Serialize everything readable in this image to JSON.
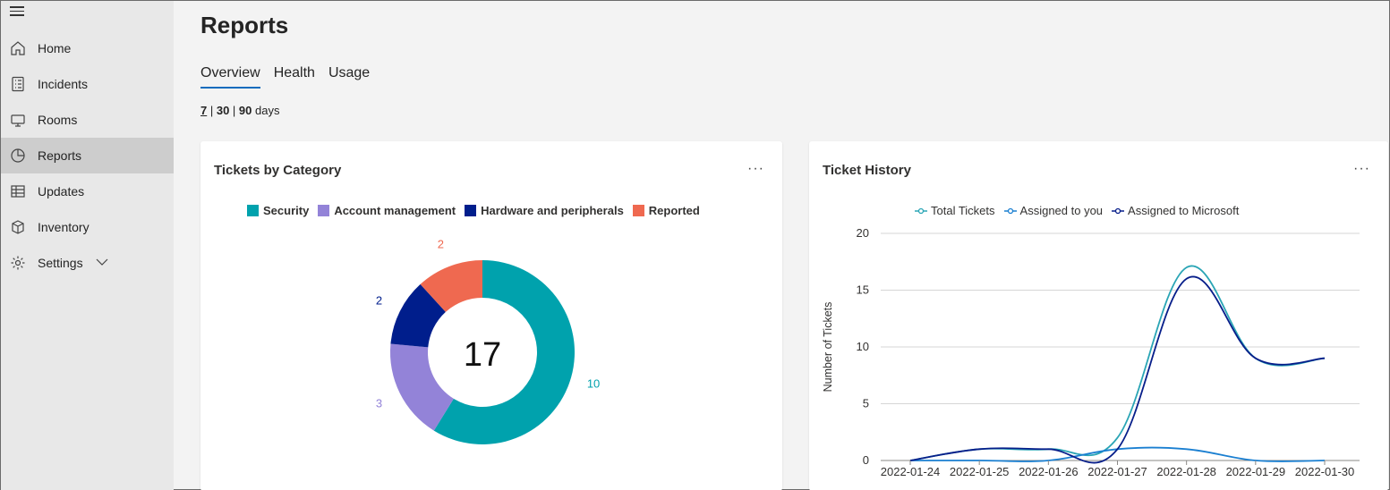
{
  "sidebar": {
    "items": [
      {
        "label": "Home",
        "icon": "home-icon"
      },
      {
        "label": "Incidents",
        "icon": "clipboard-list-icon"
      },
      {
        "label": "Rooms",
        "icon": "monitor-icon"
      },
      {
        "label": "Reports",
        "icon": "pie-chart-icon",
        "active": true
      },
      {
        "label": "Updates",
        "icon": "table-icon"
      },
      {
        "label": "Inventory",
        "icon": "box-icon"
      },
      {
        "label": "Settings",
        "icon": "gear-icon"
      }
    ]
  },
  "page": {
    "title": "Reports",
    "tabs": [
      "Overview",
      "Health",
      "Usage"
    ],
    "active_tab": "Overview",
    "range": {
      "opt1": "7",
      "sep1": " | ",
      "opt2": "30",
      "sep2": " | ",
      "opt3": "90",
      "suffix": " days"
    }
  },
  "colors": {
    "accent": "#0f6cbd",
    "security": "#00a2ad",
    "account": "#9383d8",
    "hardware": "#001e8c",
    "reported": "#ef6950",
    "total": "#2aa5b5",
    "assigned_you": "#1a7fd1",
    "assigned_ms": "#071e8a"
  },
  "cards": {
    "category": {
      "title": "Tickets by Category",
      "more": "···",
      "center_total": "17"
    },
    "history": {
      "title": "Ticket History",
      "more": "···"
    }
  },
  "chart_data": [
    {
      "type": "pie",
      "variant": "donut",
      "title": "Tickets by Category",
      "center_label": "17",
      "categories": [
        "Security",
        "Account management",
        "Hardware and peripherals",
        "Reported"
      ],
      "values": [
        10,
        3,
        2,
        2
      ],
      "colors": [
        "#00a2ad",
        "#9383d8",
        "#001e8c",
        "#ef6950"
      ],
      "legend": "top"
    },
    {
      "type": "line",
      "title": "Ticket History",
      "xlabel": "",
      "ylabel": "Number of Tickets",
      "x": [
        "2022-01-24",
        "2022-01-25",
        "2022-01-26",
        "2022-01-27",
        "2022-01-28",
        "2022-01-29",
        "2022-01-30"
      ],
      "series": [
        {
          "name": "Total Tickets",
          "values": [
            0,
            1,
            1,
            2,
            17,
            9,
            9
          ],
          "color": "#2aa5b5"
        },
        {
          "name": "Assigned to you",
          "values": [
            0,
            0,
            0,
            1,
            1,
            0,
            0
          ],
          "color": "#1a7fd1"
        },
        {
          "name": "Assigned to Microsoft",
          "values": [
            0,
            1,
            1,
            1,
            16,
            9,
            9
          ],
          "color": "#071e8a"
        }
      ],
      "ylim": [
        0,
        20
      ],
      "yticks": [
        0,
        5,
        10,
        15,
        20
      ],
      "grid": true,
      "legend": "top"
    }
  ]
}
